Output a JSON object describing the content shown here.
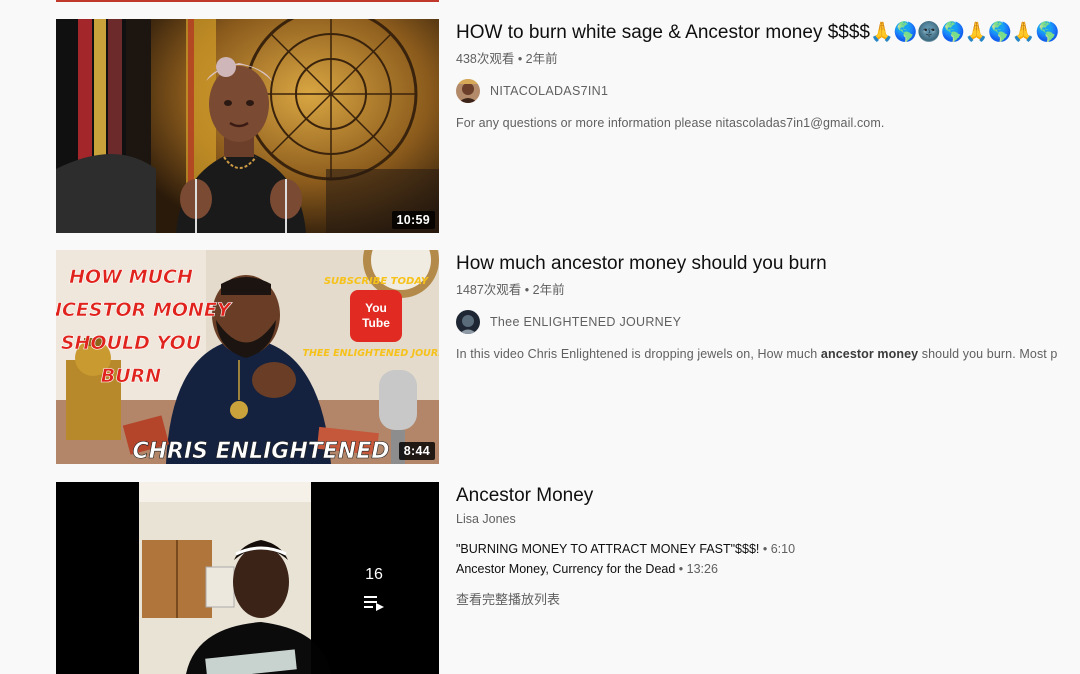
{
  "results": [
    {
      "title": "HOW to burn white sage & Ancestor money $$$$🙏🌎🌚🌎🙏🌎🙏🌎",
      "meta": "438次观看 • 2年前",
      "channel": "NITACOLADAS7IN1",
      "description": "For any questions or more information please nitascoladas7in1@gmail.com.",
      "duration": "10:59"
    },
    {
      "title": "How much ancestor money should you burn",
      "meta": "1487次观看 • 2年前",
      "channel": "Thee ENLIGHTENED JOURNEY",
      "description_parts": [
        "In this video Chris Enlightened is dropping jewels on, How much ",
        "ancestor money",
        " should you burn. Most p"
      ],
      "duration": "8:44",
      "thumb_text": {
        "line1": "HOW MUCH",
        "line2": "ANCESTOR MONEY",
        "line3": "SHOULD YOU",
        "line4": "BURN",
        "subscribe": "SUBSCRIBE TODAY",
        "yt_you": "You",
        "yt_tube": "Tube",
        "journey": "THEE ENLIGHTENED JOURNEY",
        "name": "CHRIS ENLIGHTENED"
      }
    },
    {
      "title": "Ancestor Money",
      "channel": "Lisa Jones",
      "playlist_count": "16",
      "playlist_items": [
        {
          "title": "\"BURNING MONEY TO ATTRACT MONEY FAST\"$$$!",
          "duration": "• 6:10"
        },
        {
          "title": "Ancestor Money, Currency for the Dead",
          "duration": "• 13:26"
        }
      ],
      "view_full": "查看完整播放列表"
    }
  ],
  "icons": {
    "playlist": "playlist-icon",
    "youtube_logo": "youtube-logo-icon"
  },
  "colors": {
    "background": "#f9f9f9",
    "text_primary": "#0f0f0f",
    "text_secondary": "#606060",
    "thumb2_red_text": "#e0231d",
    "thumb2_yellow_text": "#f6c21a"
  }
}
